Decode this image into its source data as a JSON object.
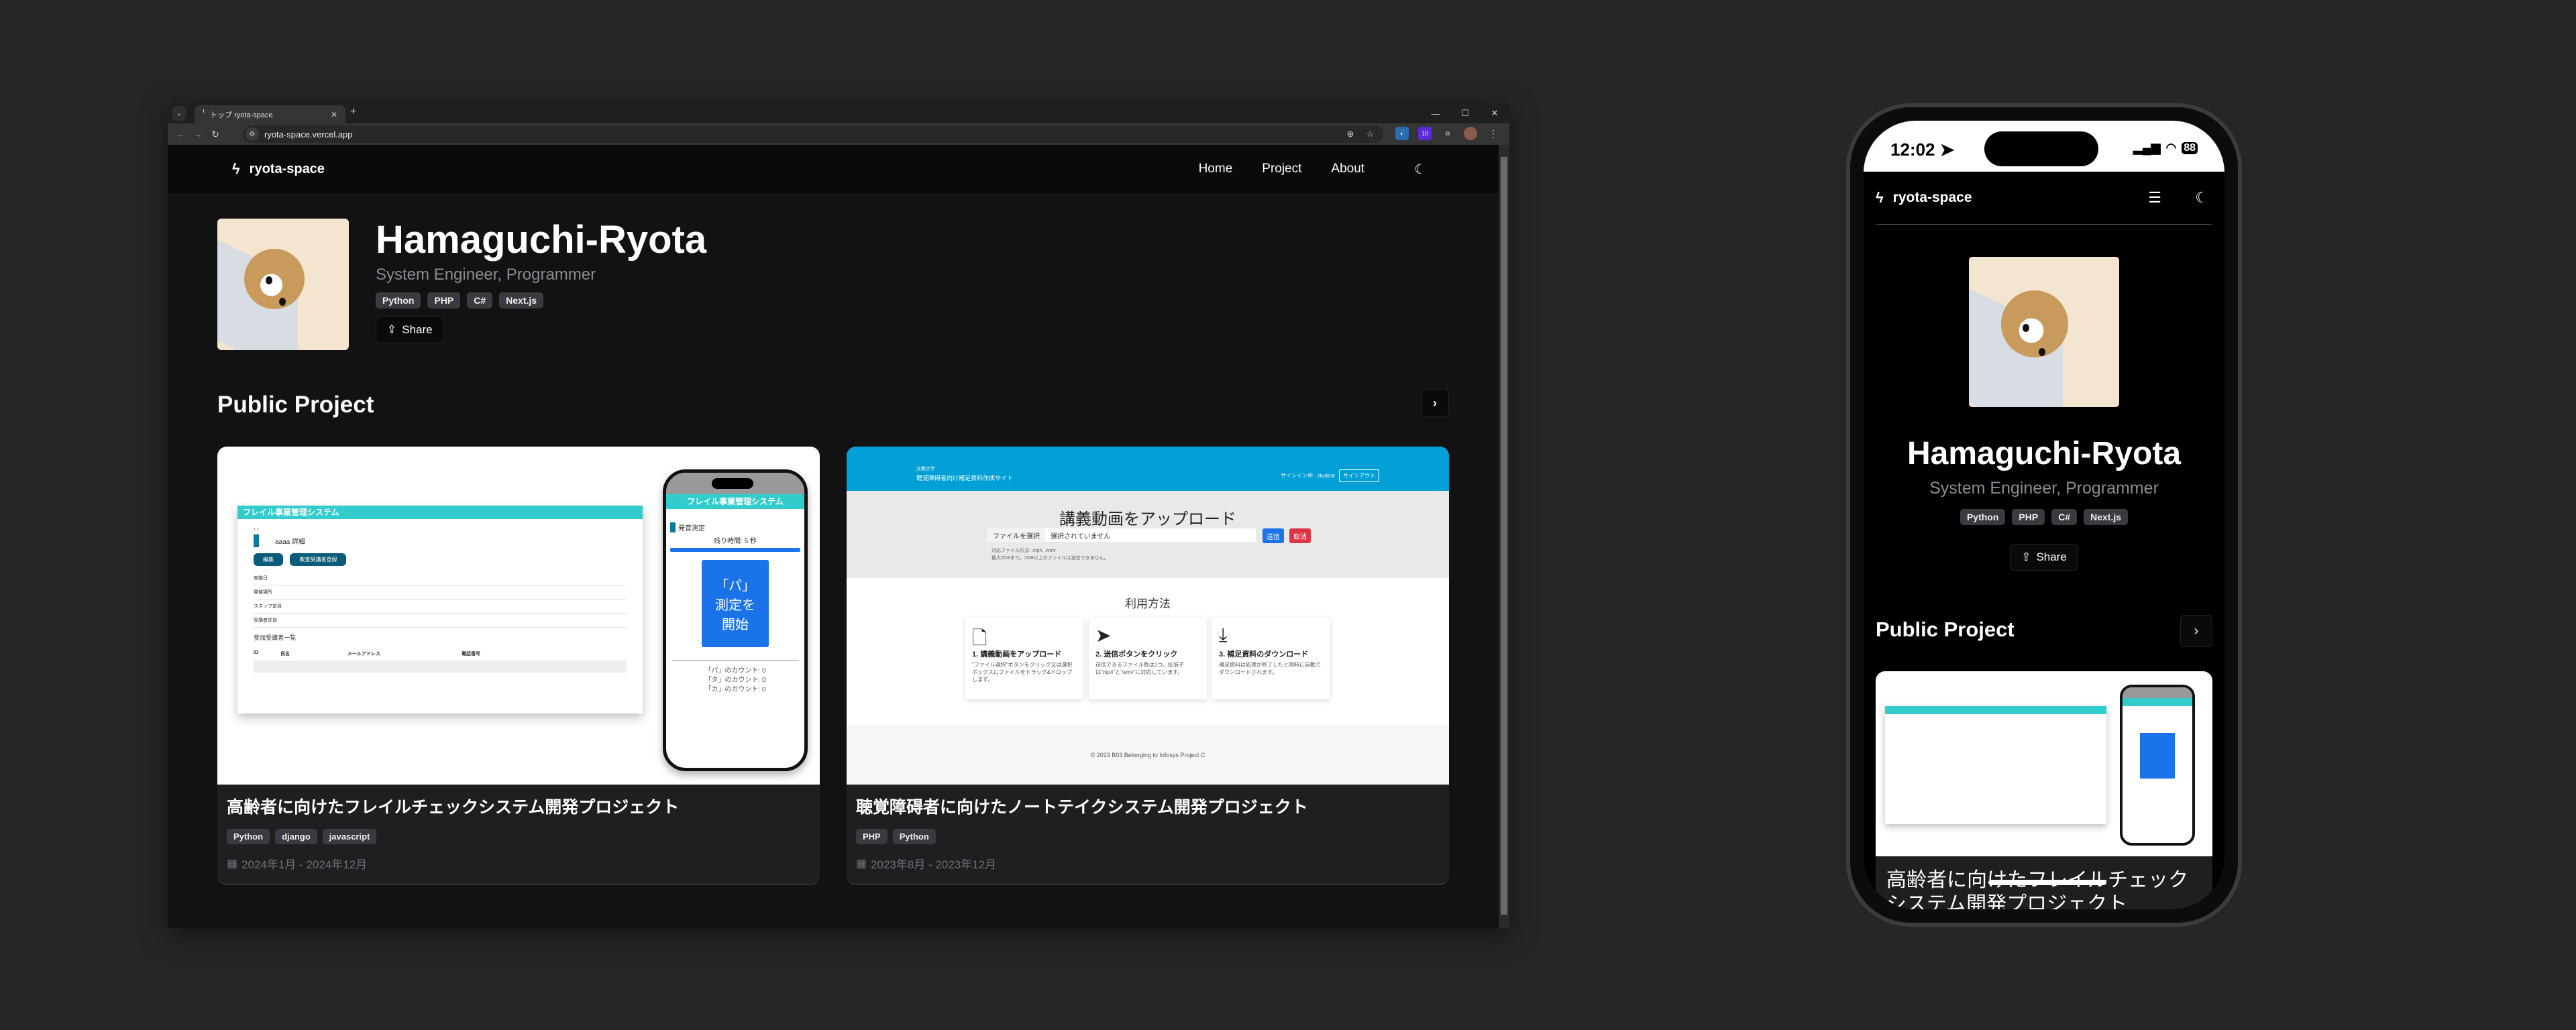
{
  "browser": {
    "tab_label": "トップ ryota-space",
    "url": "ryota-space.vercel.app",
    "extension_badge": "10",
    "window_controls": [
      "—",
      "☐",
      "✕"
    ]
  },
  "site": {
    "brand": "ryota-space",
    "nav": [
      "Home",
      "Project",
      "About"
    ],
    "profile": {
      "name": "Hamaguchi-Ryota",
      "subtitle": "System Engineer, Programmer",
      "skills": [
        "Python",
        "PHP",
        "C#",
        "Next.js"
      ],
      "share_label": "Share"
    },
    "section_title": "Public Project",
    "projects": [
      {
        "title": "高齢者に向けたフレイルチェックシステム開発プロジェクト",
        "tags": [
          "Python",
          "django",
          "javascript"
        ],
        "period": "2024年1月 - 2024年12月",
        "mock": {
          "app_title": "フレイル事業管理システム",
          "detail_heading": "aaaa 詳細",
          "buttons": [
            "編集",
            "教室受講者登録"
          ],
          "rows": [
            "実施日",
            "開催場所",
            "スタッフ定員",
            "受講者定員"
          ],
          "list_heading": "参加受講者一覧",
          "table_headers": [
            "ID",
            "氏名",
            "メールアドレス",
            "電話番号"
          ],
          "phone_heading": "発音測定",
          "remaining": "残り時間: 5 秒",
          "start_button": [
            "「パ」",
            "測定を",
            "開始"
          ],
          "counts": [
            "「パ」のカウント: 0",
            "「タ」のカウント: 0",
            "「カ」のカウント: 0"
          ]
        }
      },
      {
        "title": "聴覚障碍者に向けたノートテイクシステム開発プロジェクト",
        "tags": [
          "PHP",
          "Python"
        ],
        "period": "2023年8月 - 2023年12月",
        "mock": {
          "org": "文教大学",
          "site_title": "聴覚障碍者向け補足資料作成サイト",
          "signed_in": "サインイン中 : student",
          "signout": "サインアウト",
          "upload_heading": "講義動画をアップロード",
          "file_button": "ファイルを選択",
          "file_status": "選択されていません",
          "submit": "送信",
          "cancel": "取消",
          "notes": [
            "対応ファイル形式: .mp4, .wmv",
            "最大2GBまで。2GB以上のファイルは送信できません。"
          ],
          "howto_heading": "利用方法",
          "steps": [
            {
              "title": "1. 講義動画をアップロード",
              "text": "\"ファイル選択\"ボタンをクリック又は選択ボックスにファイルをドラッグ&ドロップします。"
            },
            {
              "title": "2. 送信ボタンをクリック",
              "text": "送信できるファイル数は1つ、拡張子は\"mp4\"と\"wmv\"に対応しています。"
            },
            {
              "title": "3. 補足資料のダウンロード",
              "text": "補足資料は処理が終了したと同時に自動でダウンロードされます。"
            }
          ],
          "footer": "© 2023 B03 Belonging to Infosys Project C"
        }
      }
    ]
  },
  "phone": {
    "time": "12:02",
    "battery": "88",
    "brand": "ryota-space",
    "card_title": "高齢者に向けたフレイルチェックシステム開発プロジェクト"
  }
}
